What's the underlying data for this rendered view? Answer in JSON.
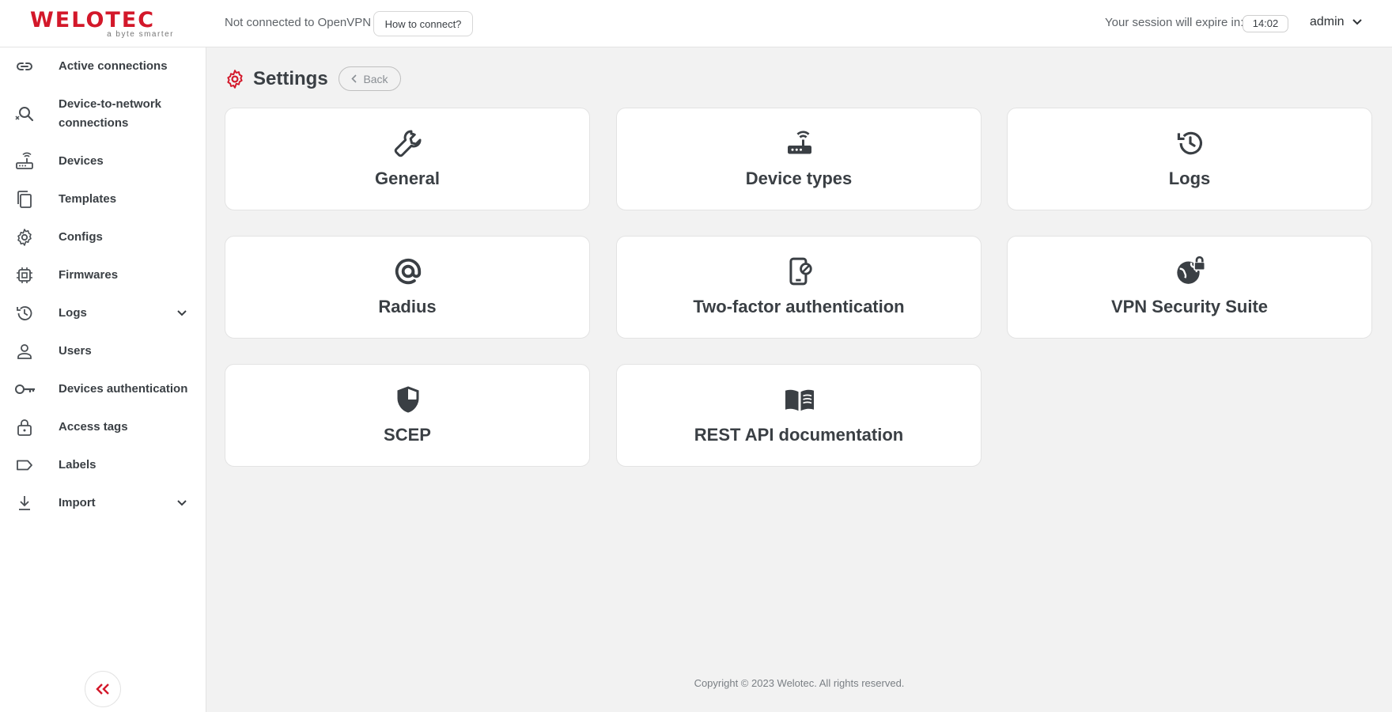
{
  "brand": {
    "name": "WELOTEC",
    "tagline": "a byte smarter",
    "accent": "#d3182a"
  },
  "header": {
    "vpn_status": "Not connected to OpenVPN",
    "connect_button": "How to connect?",
    "session_label": "Your session will expire in:",
    "session_timer": "14:02",
    "user": "admin"
  },
  "sidebar": {
    "items": [
      {
        "label": "Active connections",
        "icon": "link-icon"
      },
      {
        "label": "Device-to-network connections",
        "icon": "network-search-icon"
      },
      {
        "label": "Devices",
        "icon": "router-icon"
      },
      {
        "label": "Templates",
        "icon": "copy-icon"
      },
      {
        "label": "Configs",
        "icon": "gear-icon"
      },
      {
        "label": "Firmwares",
        "icon": "chip-icon"
      },
      {
        "label": "Logs",
        "icon": "history-icon",
        "expandable": true
      },
      {
        "label": "Users",
        "icon": "user-icon"
      },
      {
        "label": "Devices authentication",
        "icon": "key-icon"
      },
      {
        "label": "Access tags",
        "icon": "lock-icon"
      },
      {
        "label": "Labels",
        "icon": "label-icon"
      },
      {
        "label": "Import",
        "icon": "download-icon",
        "expandable": true
      }
    ]
  },
  "page": {
    "title": "Settings",
    "back_label": "Back",
    "cards": [
      {
        "label": "General",
        "icon": "wrench-icon"
      },
      {
        "label": "Device types",
        "icon": "router-icon"
      },
      {
        "label": "Logs",
        "icon": "history-icon"
      },
      {
        "label": "Radius",
        "icon": "at-sign-icon"
      },
      {
        "label": "Two-factor authentication",
        "icon": "phone-lock-icon"
      },
      {
        "label": "VPN Security Suite",
        "icon": "globe-lock-icon"
      },
      {
        "label": "SCEP",
        "icon": "shield-icon"
      },
      {
        "label": "REST API documentation",
        "icon": "book-icon"
      }
    ]
  },
  "footer": {
    "copyright": "Copyright © 2023 Welotec. All rights reserved."
  }
}
